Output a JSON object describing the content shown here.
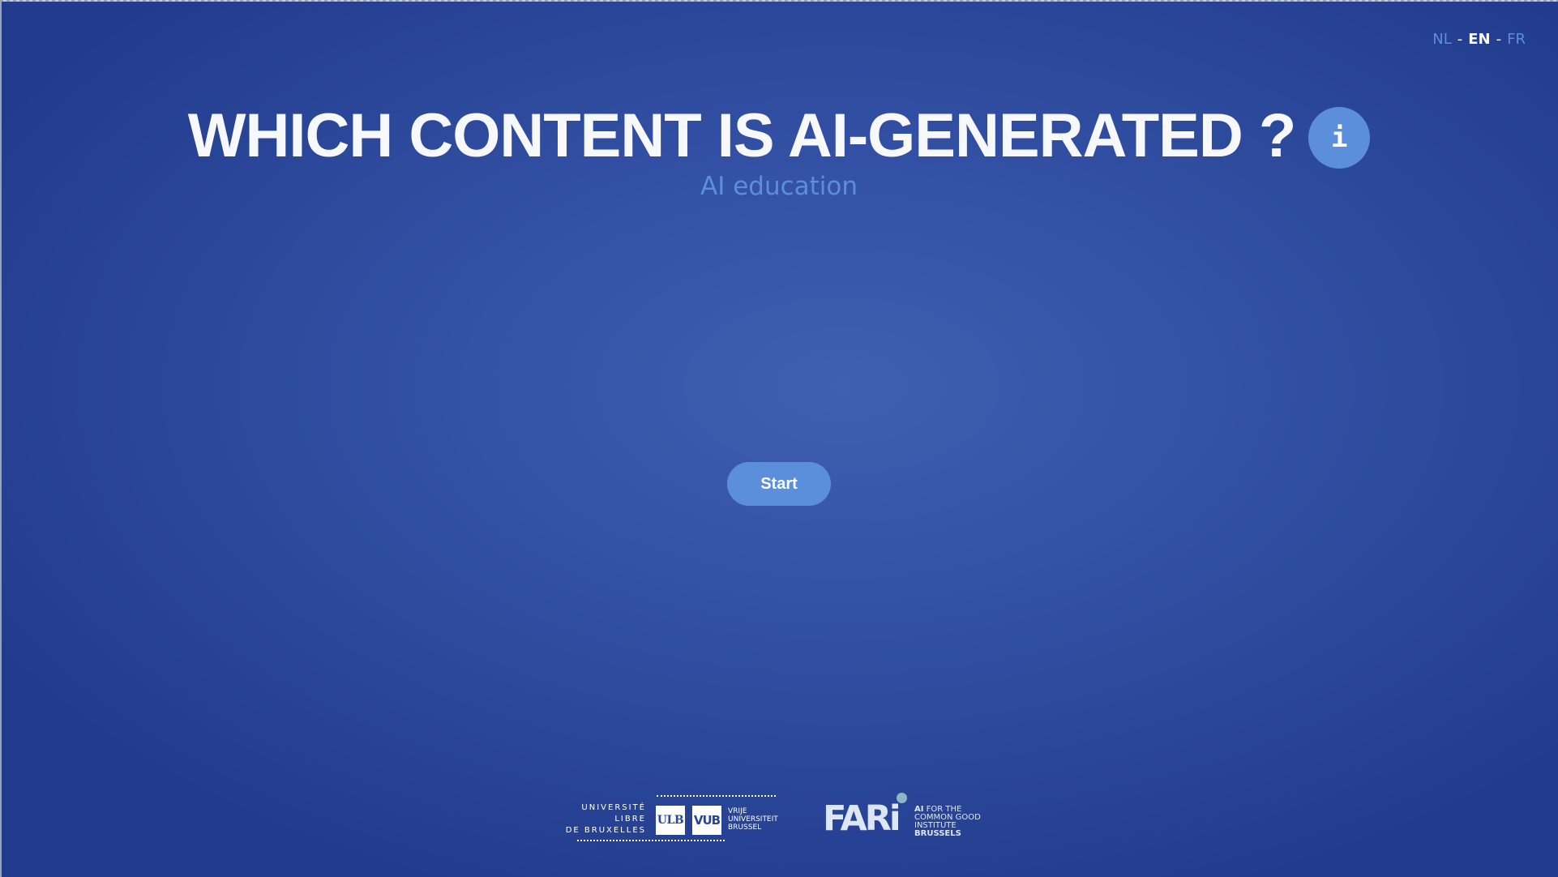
{
  "languages": {
    "items": [
      {
        "code": "NL",
        "active": false
      },
      {
        "code": "EN",
        "active": true
      },
      {
        "code": "FR",
        "active": false
      }
    ],
    "separator": "-"
  },
  "header": {
    "title": "WHICH CONTENT IS AI-GENERATED ?",
    "info_label": "i",
    "subtitle": "AI education"
  },
  "main": {
    "start_label": "Start"
  },
  "footer": {
    "ulb_lines": [
      "UNIVERSITÉ",
      "LIBRE",
      "DE BRUXELLES"
    ],
    "ulb_box": "ULB",
    "vub_box": "VUB",
    "vub_lines": [
      "VRIJE",
      "UNIVERSITEIT",
      "BRUSSEL"
    ],
    "fari_word": "FARi",
    "fari_tag_ai": "AI",
    "fari_tag_lines": [
      "FOR THE",
      "COMMON GOOD",
      "INSTITUTE",
      "BRUSSELS"
    ]
  },
  "colors": {
    "accent": "#5b8fdc",
    "background": "#2f4ea3",
    "text": "#ffffff"
  }
}
